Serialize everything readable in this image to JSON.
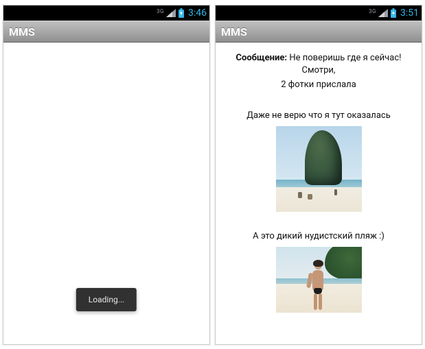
{
  "left": {
    "status": {
      "net": "3G",
      "time": "3:46"
    },
    "title": "MMS",
    "toast": "Loading..."
  },
  "right": {
    "status": {
      "net": "3G",
      "time": "3:51"
    },
    "title": "MMS",
    "message": {
      "label": "Сообщение:",
      "text_line1": "Не поверишь где я сейчас! Смотри,",
      "text_line2": "2 фотки прислала",
      "caption1": "Даже не верю что я тут оказалась",
      "caption2": "А это дикий нудистский пляж :)"
    }
  }
}
